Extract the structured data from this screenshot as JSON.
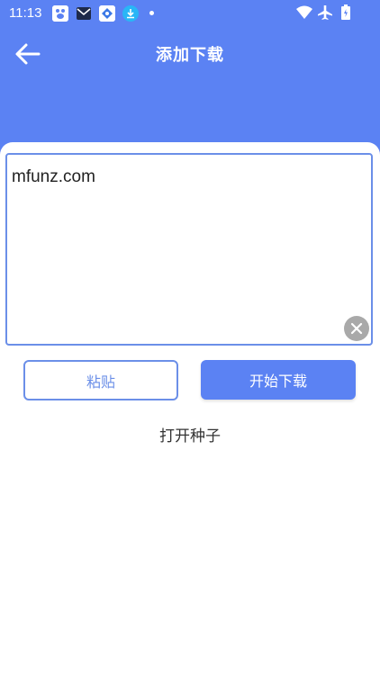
{
  "status_bar": {
    "time": "11:13",
    "notifications": [
      "baidu-netdisk-icon",
      "mail-icon",
      "app-store-icon",
      "download-icon"
    ],
    "system_icons": [
      "wifi-icon",
      "airplane-icon",
      "battery-icon"
    ]
  },
  "header": {
    "title": "添加下载",
    "back_icon": "arrow-left-icon"
  },
  "url_input": {
    "value": "mfunz.com",
    "clear_icon": "close-icon"
  },
  "actions": {
    "paste_label": "粘贴",
    "start_label": "开始下载",
    "open_torrent_label": "打开种子"
  },
  "colors": {
    "primary": "#5b82f3",
    "border": "#6b8fe8",
    "clear_button": "#a9a9a9"
  }
}
